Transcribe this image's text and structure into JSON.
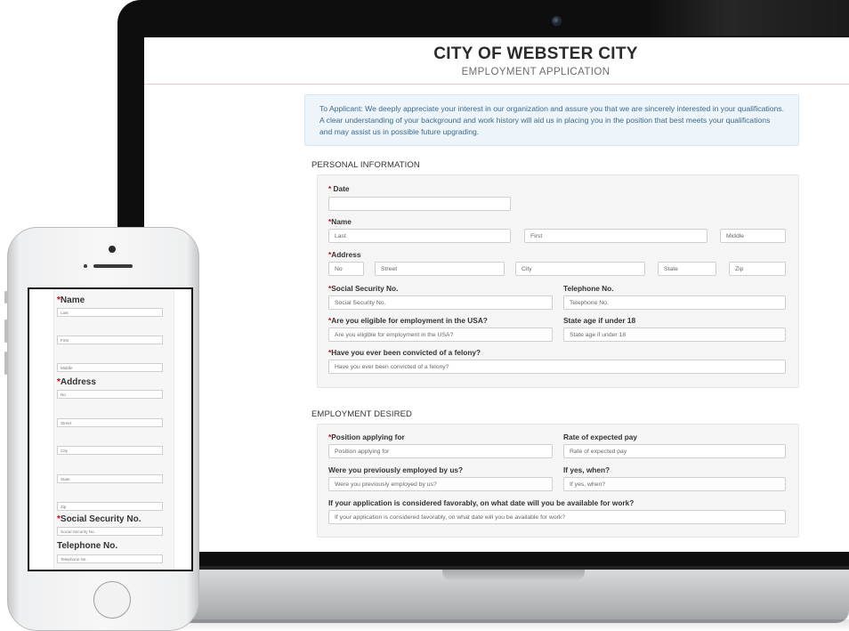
{
  "form": {
    "title": "CITY OF WEBSTER CITY",
    "subtitle": "EMPLOYMENT APPLICATION",
    "intro": "To Applicant: We deeply appreciate your interest in our organization and assure you that we are sincerely interested in your qualifications. A clear understanding of your background and work history will aid us in placing you in the position that best meets your qualifications and may assist us in possible future upgrading.",
    "required_mark": "*",
    "personal": {
      "section_title": "PERSONAL INFORMATION",
      "date_label": "Date",
      "name_label": "Name",
      "name_last": "Last",
      "name_first": "First",
      "name_middle": "Middle",
      "address_label": "Address",
      "address_no": "No",
      "address_street": "Street",
      "address_city": "City",
      "address_state": "State",
      "address_zip": "Zip",
      "ssn_label": "Social Security No.",
      "ssn_placeholder": "Social Security No.",
      "phone_label": "Telephone No.",
      "phone_placeholder": "Telephone No.",
      "eligible_label": "Are you eligible for employment in the USA?",
      "eligible_placeholder": "Are you eligible for employment in the USA?",
      "age_label": "State age if under 18",
      "age_placeholder": "State age if under 18",
      "felony_label": "Have you ever been convicted of a felony?",
      "felony_placeholder": "Have you ever been convicted of a felony?"
    },
    "employment": {
      "section_title": "EMPLOYMENT DESIRED",
      "position_label": "Position applying for",
      "position_placeholder": "Position applying for",
      "pay_label": "Rate of expected pay",
      "pay_placeholder": "Rate of expected pay",
      "prev_label": "Were you previously employed by us?",
      "prev_placeholder": "Were you previously employed by us?",
      "when_label": "If yes, when?",
      "when_placeholder": "If yes, when?",
      "available_label": "If your application is considered favorably, on what date will you be available for work?",
      "available_placeholder": "If your application is considered favorably, on what date will you be available for work?"
    }
  },
  "mobile": {
    "name_label": "Name",
    "last": "Last",
    "first": "First",
    "middle": "Middle",
    "address_label": "Address",
    "no": "No",
    "street": "Street",
    "city": "City",
    "state": "State",
    "zip": "Zip",
    "ssn_label": "Social Security No.",
    "ssn_placeholder": "Social Security No.",
    "phone_label": "Telephone No.",
    "phone_placeholder": "Telephone No."
  },
  "colors": {
    "required": "#d0021b",
    "intro_bg": "#eef5fa",
    "intro_text": "#3a6a8e",
    "panel_bg": "#f5f5f5"
  }
}
